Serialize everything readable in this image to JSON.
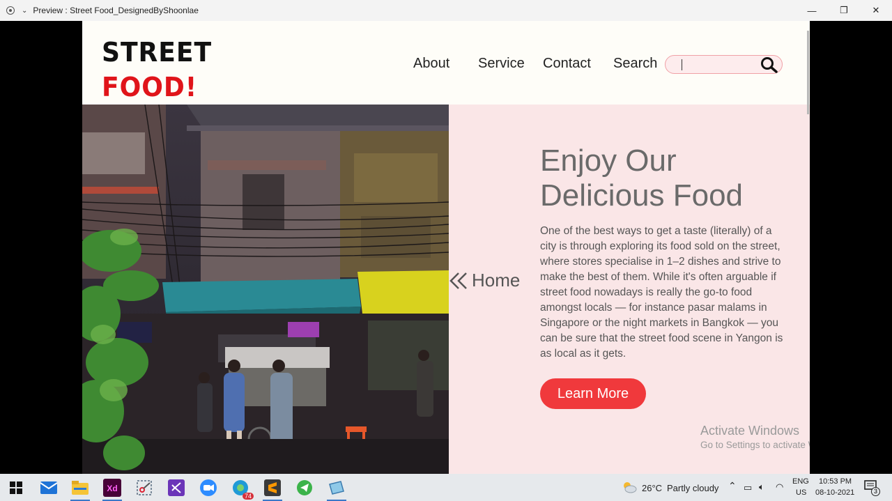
{
  "window": {
    "title": "Preview : Street Food_DesignedByShoonlae",
    "controls": {
      "minimize": "—",
      "restore": "❐",
      "close": "✕"
    }
  },
  "header": {
    "logo_line1": "STREET",
    "logo_line2": "FOOD!",
    "nav": [
      "About",
      "Service",
      "Contact",
      "Search"
    ],
    "search_value": ""
  },
  "hero": {
    "home_label": "Home",
    "headline": "Enjoy Our Delicious Food",
    "body": "One of the best ways to get a taste (literally) of a city is through exploring its food sold on the street, where stores specialise in 1–2 dishes and strive to make the best of them. While it's often arguable if street food nowadays is really the go-to food amongst locals — for instance pasar malams in Singapore or the night markets in Bangkok — you can be sure that the street food scene in Yangon is as local as it gets.",
    "cta_label": "Learn More"
  },
  "watermark": {
    "line1": "Activate Windows",
    "line2": "Go to Settings to activate Windows."
  },
  "taskbar": {
    "apps": [
      "start-icon",
      "mail-icon",
      "file-explorer-icon",
      "adobe-xd-icon",
      "snipping-tool-icon",
      "visual-studio-icon",
      "zoom-icon",
      "edge-icon",
      "sublime-text-icon",
      "telegram-icon",
      "notepad-icon"
    ],
    "edge_badge": "74",
    "weather_temp": "26°C",
    "weather_desc": "Partly cloudy",
    "lang_line1": "ENG",
    "lang_line2": "US",
    "time": "10:53 PM",
    "date": "08-10-2021",
    "notifications": "3"
  },
  "colors": {
    "accent": "#f0393c",
    "logo_red": "#e0141a",
    "panel_bg": "#fae6e7"
  }
}
